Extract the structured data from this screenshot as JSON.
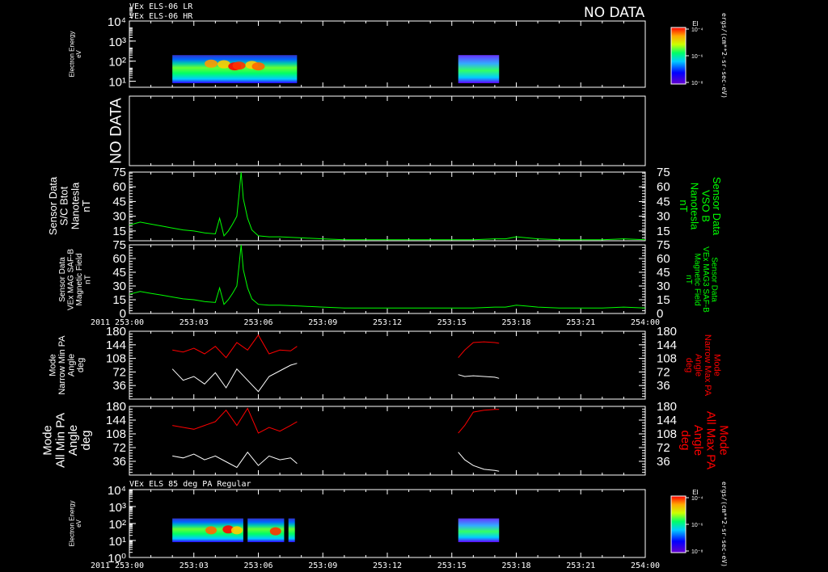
{
  "header": {
    "line1": "VEx ELS-06 LR",
    "line2": "VEx ELS-06 HR",
    "no_data_top": "NO DATA",
    "bottom_panel_title": "VEx ELS 85 deg PA Regular"
  },
  "colors": {
    "background": "#000000",
    "axes": "#ffffff",
    "mag": "#00ff00",
    "max_pa": "#ff0000",
    "min_pa": "#ffffff"
  },
  "time_axis": {
    "year_label": "2011",
    "tick_labels": [
      "253:00",
      "253:03",
      "253:06",
      "253:09",
      "253:12",
      "253:15",
      "253:18",
      "253:21",
      "254:00"
    ]
  },
  "colorbar": {
    "title": "EI",
    "tick_labels": [
      "10⁻⁴",
      "10⁻⁶",
      "10⁻⁸"
    ],
    "unit_label": "ergs/(cm**2-sr-sec-eV)"
  },
  "panels": {
    "p1": {
      "ylabel": [
        "Electron Energy",
        "eV"
      ],
      "ticks": [
        "10⁴",
        "10³",
        "10²",
        "10¹"
      ]
    },
    "p2": {
      "ylabel": [
        "NO DATA"
      ]
    },
    "p3": {
      "ylabel": [
        "Sensor Data",
        "S/C Btot",
        "Nanotesla",
        "nT"
      ],
      "right_label": [
        "Sensor Data",
        "VSO B",
        "Nanotesla",
        "nT"
      ],
      "ticks": [
        "75",
        "60",
        "45",
        "30",
        "15"
      ]
    },
    "p4": {
      "ylabel": [
        "Sensor Data",
        "VEx MAG SAF-B",
        "Magnetic Field",
        "nT"
      ],
      "right_label": [
        "Sensor Data",
        "VEx MAG3 SAF-B",
        "Magnetic Field",
        "nT"
      ],
      "ticks": [
        "75",
        "60",
        "45",
        "30",
        "15",
        "0"
      ]
    },
    "p5": {
      "ylabel": [
        "Mode",
        "Narrow Min PA",
        "Angle",
        "deg"
      ],
      "right_label": [
        "Mode",
        "Narrow Max PA",
        "Angle",
        "deg"
      ],
      "ticks": [
        "180",
        "144",
        "108",
        "72",
        "36"
      ]
    },
    "p6": {
      "ylabel": [
        "Mode",
        "All Min PA",
        "Angle",
        "deg"
      ],
      "right_label": [
        "Mode",
        "All Max PA",
        "Angle",
        "deg"
      ],
      "ticks": [
        "180",
        "144",
        "108",
        "72",
        "36"
      ]
    },
    "p7": {
      "ylabel": [
        "Electron Energy",
        "eV"
      ],
      "ticks": [
        "10⁴",
        "10³",
        "10²",
        "10¹",
        "10⁰"
      ]
    }
  },
  "chart_data": [
    {
      "type": "heatmap",
      "title": "VEx ELS-06 LR / HR",
      "ylabel": "Electron Energy eV",
      "y_scale": "log",
      "ylim": [
        1,
        10000
      ],
      "xlim_minutes": [
        0,
        24
      ],
      "blocks": [
        {
          "t_start": 2.0,
          "t_end": 7.8,
          "e_min": 8,
          "e_max": 200
        },
        {
          "t_start": 15.3,
          "t_end": 17.2,
          "e_min": 8,
          "e_max": 200
        }
      ]
    },
    {
      "type": "line",
      "title": "S/C Btot",
      "ylabel": "Nanotesla nT",
      "ylim": [
        0,
        75
      ],
      "x_minutes": [
        0,
        0.5,
        1,
        1.5,
        2,
        2.5,
        3,
        3.5,
        4,
        4.2,
        4.4,
        4.6,
        4.8,
        5,
        5.1,
        5.2,
        5.3,
        5.5,
        5.7,
        6,
        6.5,
        7,
        8,
        9,
        10,
        11,
        12,
        13,
        14,
        15,
        16,
        17,
        17.5,
        18,
        18.5,
        19,
        20,
        21,
        22,
        23,
        24
      ],
      "values": [
        21,
        24,
        22,
        20,
        18,
        16,
        15,
        13,
        12,
        28,
        10,
        15,
        22,
        30,
        52,
        75,
        48,
        28,
        16,
        10,
        9,
        9,
        8,
        7,
        6,
        6,
        6,
        6,
        6,
        6,
        6,
        7,
        7,
        9,
        8,
        7,
        6,
        6,
        6,
        7,
        6
      ]
    },
    {
      "type": "line",
      "title": "VEx MAG SAF-B",
      "ylabel": "Magnetic Field nT",
      "ylim": [
        0,
        75
      ],
      "x_minutes": [
        0,
        0.5,
        1,
        1.5,
        2,
        2.5,
        3,
        3.5,
        4,
        4.2,
        4.4,
        4.6,
        4.8,
        5,
        5.1,
        5.2,
        5.3,
        5.5,
        5.7,
        6,
        6.5,
        7,
        8,
        9,
        10,
        11,
        12,
        13,
        14,
        15,
        16,
        17,
        17.5,
        18,
        18.5,
        19,
        20,
        21,
        22,
        23,
        24
      ],
      "values": [
        21,
        24,
        22,
        20,
        18,
        16,
        15,
        13,
        12,
        28,
        10,
        15,
        22,
        30,
        52,
        75,
        48,
        28,
        16,
        10,
        9,
        9,
        8,
        7,
        6,
        6,
        6,
        6,
        6,
        6,
        6,
        7,
        7,
        9,
        8,
        7,
        6,
        6,
        6,
        7,
        6
      ]
    },
    {
      "type": "line",
      "title": "Narrow Min/Max PA",
      "ylabel": "Angle deg",
      "ylim": [
        0,
        180
      ],
      "series": [
        {
          "name": "Narrow Max PA",
          "x_minutes": [
            2,
            2.5,
            3,
            3.5,
            4,
            4.5,
            5,
            5.5,
            6,
            6.5,
            7,
            7.5,
            7.8
          ],
          "values": [
            130,
            125,
            135,
            120,
            140,
            110,
            150,
            130,
            170,
            120,
            130,
            128,
            140
          ]
        },
        {
          "name": "Narrow Max PA (2)",
          "x_minutes": [
            15.3,
            15.6,
            16,
            16.5,
            17,
            17.2
          ],
          "values": [
            110,
            130,
            150,
            152,
            150,
            148
          ]
        },
        {
          "name": "Narrow Min PA",
          "x_minutes": [
            2,
            2.5,
            3,
            3.5,
            4,
            4.5,
            5,
            5.5,
            6,
            6.5,
            7,
            7.5,
            7.8
          ],
          "values": [
            80,
            50,
            60,
            40,
            70,
            30,
            80,
            50,
            20,
            60,
            75,
            90,
            95
          ]
        },
        {
          "name": "Narrow Min PA (2)",
          "x_minutes": [
            15.3,
            15.6,
            16,
            16.5,
            17,
            17.2
          ],
          "values": [
            65,
            60,
            62,
            60,
            58,
            55
          ]
        }
      ]
    },
    {
      "type": "line",
      "title": "All Min/Max PA",
      "ylabel": "Angle deg",
      "ylim": [
        0,
        180
      ],
      "series": [
        {
          "name": "All Max PA",
          "x_minutes": [
            2,
            2.5,
            3,
            3.5,
            4,
            4.5,
            5,
            5.5,
            6,
            6.5,
            7,
            7.5,
            7.8
          ],
          "values": [
            130,
            125,
            120,
            130,
            140,
            170,
            130,
            175,
            110,
            125,
            115,
            130,
            140
          ]
        },
        {
          "name": "All Max PA (2)",
          "x_minutes": [
            15.3,
            15.6,
            16,
            16.5,
            17,
            17.2
          ],
          "values": [
            110,
            130,
            165,
            170,
            172,
            172
          ]
        },
        {
          "name": "All Min PA",
          "x_minutes": [
            2,
            2.5,
            3,
            3.5,
            4,
            4.5,
            5,
            5.5,
            6,
            6.5,
            7,
            7.5,
            7.8
          ],
          "values": [
            50,
            45,
            55,
            40,
            50,
            35,
            20,
            60,
            25,
            50,
            40,
            45,
            30
          ]
        },
        {
          "name": "All Min PA (2)",
          "x_minutes": [
            15.3,
            15.6,
            16,
            16.5,
            17,
            17.2
          ],
          "values": [
            60,
            40,
            25,
            15,
            12,
            10
          ]
        }
      ]
    },
    {
      "type": "heatmap",
      "title": "VEx ELS 85 deg PA Regular",
      "ylabel": "Electron Energy eV",
      "y_scale": "log",
      "ylim": [
        1,
        10000
      ],
      "xlim_minutes": [
        0,
        24
      ],
      "blocks": [
        {
          "t_start": 2.0,
          "t_end": 5.3,
          "e_min": 8,
          "e_max": 200
        },
        {
          "t_start": 5.5,
          "t_end": 7.2,
          "e_min": 8,
          "e_max": 200
        },
        {
          "t_start": 7.4,
          "t_end": 7.7,
          "e_min": 8,
          "e_max": 200
        },
        {
          "t_start": 15.3,
          "t_end": 17.2,
          "e_min": 8,
          "e_max": 200
        }
      ]
    }
  ]
}
